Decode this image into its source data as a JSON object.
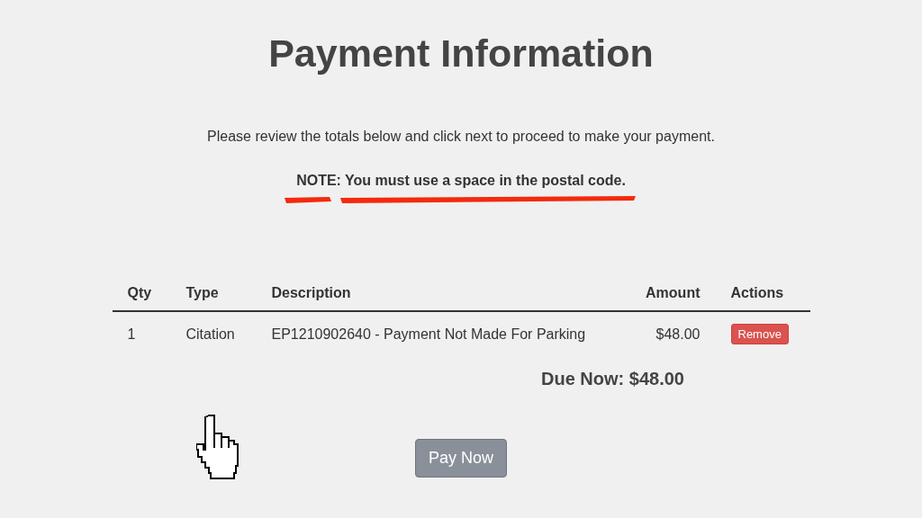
{
  "title": "Payment Information",
  "intro": "Please review the totals below and click next to proceed to make your payment.",
  "note": "NOTE: You must use a space in the postal code.",
  "table": {
    "columns": [
      "Qty",
      "Type",
      "Description",
      "Amount",
      "Actions"
    ],
    "rows": [
      {
        "qty": "1",
        "type": "Citation",
        "description": "EP1210902640 - Payment Not Made For Parking",
        "amount": "$48.00",
        "action": "Remove"
      }
    ]
  },
  "due_now": "Due Now: $48.00",
  "pay_button": "Pay Now"
}
